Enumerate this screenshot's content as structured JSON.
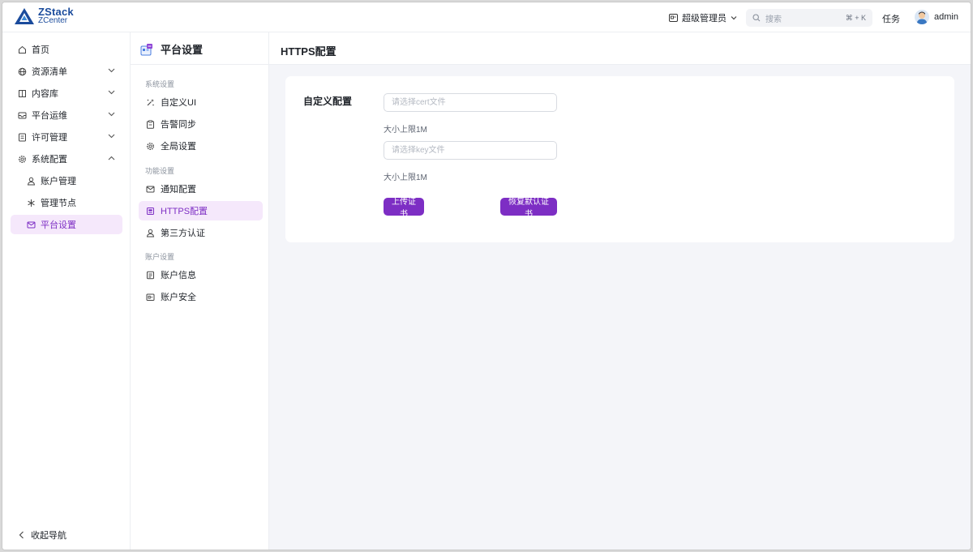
{
  "app": {
    "logo_main": "ZStack",
    "logo_sub": "ZCenter",
    "brand_color": "#1a4b9c",
    "accent_color": "#7d2ec4"
  },
  "topbar": {
    "role_label": "超级管理员",
    "search_placeholder": "搜索",
    "search_shortcut": "⌘ + K",
    "tasks_label": "任务",
    "user_name": "admin"
  },
  "leftnav": {
    "items": [
      {
        "label": "首页",
        "icon": "home-icon"
      },
      {
        "label": "资源清单",
        "icon": "globe-icon"
      },
      {
        "label": "内容库",
        "icon": "book-icon"
      },
      {
        "label": "平台运维",
        "icon": "inbox-icon"
      },
      {
        "label": "许可管理",
        "icon": "license-icon"
      },
      {
        "label": "系统配置",
        "icon": "gear-icon"
      },
      {
        "label": "账户管理",
        "icon": "user-icon"
      },
      {
        "label": "管理节点",
        "icon": "asterisk-icon"
      },
      {
        "label": "平台设置",
        "icon": "mail-icon"
      }
    ],
    "collapse_label": "收起导航"
  },
  "midnav": {
    "title": "平台设置",
    "groups": [
      "系统设置",
      "功能设置",
      "账户设置"
    ],
    "items": [
      {
        "label": "自定义UI",
        "icon": "magic-icon"
      },
      {
        "label": "告警同步",
        "icon": "clipboard-icon"
      },
      {
        "label": "全局设置",
        "icon": "gear-icon"
      },
      {
        "label": "通知配置",
        "icon": "mail-icon"
      },
      {
        "label": "HTTPS配置",
        "icon": "certificate-icon"
      },
      {
        "label": "第三方认证",
        "icon": "user-icon"
      },
      {
        "label": "账户信息",
        "icon": "document-icon"
      },
      {
        "label": "账户安全",
        "icon": "shield-icon"
      }
    ]
  },
  "main": {
    "title": "HTTPS配置",
    "section_label": "自定义配置",
    "cert_placeholder": "请选择cert文件",
    "key_placeholder": "请选择key文件",
    "size_hint": "大小上限1M",
    "upload_button": "上传证书",
    "reset_button": "恢复默认证书"
  }
}
